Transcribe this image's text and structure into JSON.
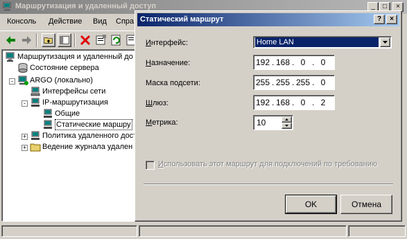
{
  "main_window": {
    "title": "Маршрутизация и удаленный доступ",
    "controls": {
      "minimize": "_",
      "maximize": "□",
      "close": "×"
    }
  },
  "menu": {
    "items": [
      {
        "label": "Консоль"
      },
      {
        "label": "Действие"
      },
      {
        "label": "Вид"
      },
      {
        "label": "Спра"
      }
    ]
  },
  "toolbar": {
    "icons": [
      "back-arrow-icon",
      "forward-arrow-icon",
      "up-folder-icon",
      "show-tree-icon",
      "delete-icon",
      "properties-icon",
      "refresh-icon",
      "export-icon"
    ]
  },
  "tree": {
    "items": [
      {
        "label": "Маршрутизация и удаленный до",
        "icon": "routing-computer-icon",
        "level": 0
      },
      {
        "label": "Состояние сервера",
        "icon": "server-status-icon",
        "level": 1
      },
      {
        "label": "ARGO (локально)",
        "icon": "server-icon",
        "level": 1,
        "expander": "-"
      },
      {
        "label": "Интерфейсы сети",
        "icon": "network-interfaces-icon",
        "level": 2
      },
      {
        "label": "IP-маршрутизация",
        "icon": "ip-routing-icon",
        "level": 2,
        "expander": "-"
      },
      {
        "label": "Общие",
        "icon": "general-icon",
        "level": 3
      },
      {
        "label": "Статические маршру",
        "icon": "static-routes-icon",
        "level": 3,
        "selected": true
      },
      {
        "label": "Политика удаленного досту",
        "icon": "policy-icon",
        "level": 2,
        "expander": "+"
      },
      {
        "label": "Ведение журнала удален",
        "icon": "folder-icon",
        "level": 2,
        "expander": "+"
      }
    ]
  },
  "dialog": {
    "title": "Статический маршрут",
    "help_button": "?",
    "close_button": "×",
    "interface": {
      "label": "Интерфейс:",
      "underline": "И",
      "rest": "нтерфейс:",
      "value": "Home LAN"
    },
    "destination": {
      "label_pre": "",
      "underline": "Н",
      "label_post": "азначение:",
      "octets": [
        "192",
        "168",
        "0",
        "0"
      ]
    },
    "mask": {
      "label": "Маска подсети:",
      "octets": [
        "255",
        "255",
        "255",
        "0"
      ]
    },
    "gateway": {
      "label_pre": "",
      "underline": "Ш",
      "label_post": "люз:",
      "octets": [
        "192",
        "168",
        "0",
        "2"
      ]
    },
    "metric": {
      "label_pre": "",
      "underline": "М",
      "label_post": "етрика:",
      "value": "10"
    },
    "demand_dial": {
      "label_pre": "",
      "underline": "И",
      "label_post": "спользовать этот маршрут для подключений по требованию",
      "checked": false,
      "enabled": false
    },
    "ok_label": "OK",
    "cancel_label": "Отмена"
  }
}
